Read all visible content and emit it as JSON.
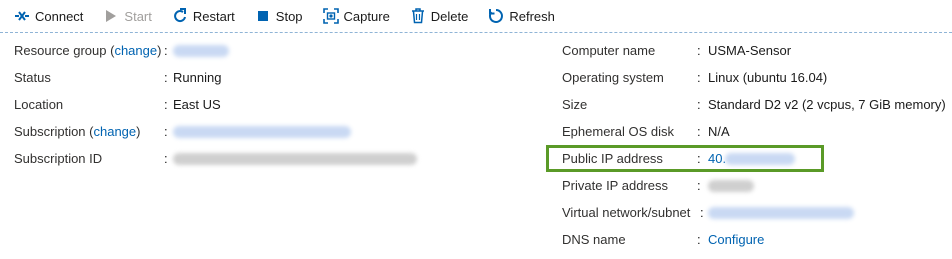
{
  "toolbar": {
    "connect": "Connect",
    "start": "Start",
    "restart": "Restart",
    "stop": "Stop",
    "capture": "Capture",
    "delete": "Delete",
    "refresh": "Refresh"
  },
  "left": {
    "resource_group": {
      "label": "Resource group (",
      "link": "change",
      "close": ")"
    },
    "status": {
      "label": "Status",
      "value": "Running"
    },
    "location": {
      "label": "Location",
      "value": "East US"
    },
    "subscription": {
      "label": "Subscription (",
      "link": "change",
      "close": ")"
    },
    "subscription_id": {
      "label": "Subscription ID"
    }
  },
  "right": {
    "computer_name": {
      "label": "Computer name",
      "value": "USMA-Sensor"
    },
    "os": {
      "label": "Operating system",
      "value": "Linux (ubuntu 16.04)"
    },
    "size": {
      "label": "Size",
      "value": "Standard D2 v2 (2 vcpus, 7 GiB memory)"
    },
    "ephemeral": {
      "label": "Ephemeral OS disk",
      "value": "N/A"
    },
    "public_ip": {
      "label": "Public IP address",
      "value": "40."
    },
    "private_ip": {
      "label": "Private IP address"
    },
    "vnet": {
      "label": "Virtual network/subnet"
    },
    "dns": {
      "label": "DNS name",
      "value": "Configure"
    }
  },
  "separator": ":",
  "colors": {
    "accent": "#0063b1",
    "highlight": "#5a9a27"
  }
}
